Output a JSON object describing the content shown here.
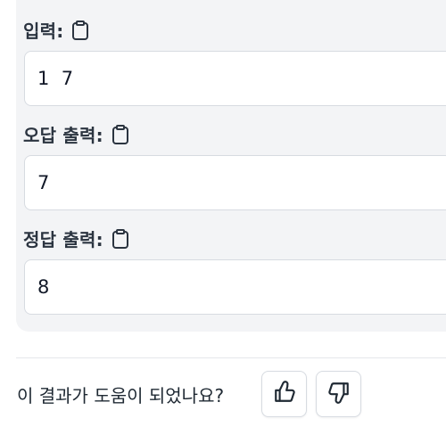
{
  "test_case": {
    "input_label": "입력:",
    "input_value": "1  7",
    "wrong_output_label": "오답 출력:",
    "wrong_output_value": "7",
    "correct_output_label": "정답 출력:",
    "correct_output_value": "8"
  },
  "feedback": {
    "question": "이 결과가 도움이 되었나요?",
    "thumbs_up_icon": "thumbs-up-icon",
    "thumbs_down_icon": "thumbs-down-icon"
  },
  "colors": {
    "panel_bg": "#f3f4f6",
    "field_border": "#d7dbe1",
    "text": "#1f2933"
  }
}
